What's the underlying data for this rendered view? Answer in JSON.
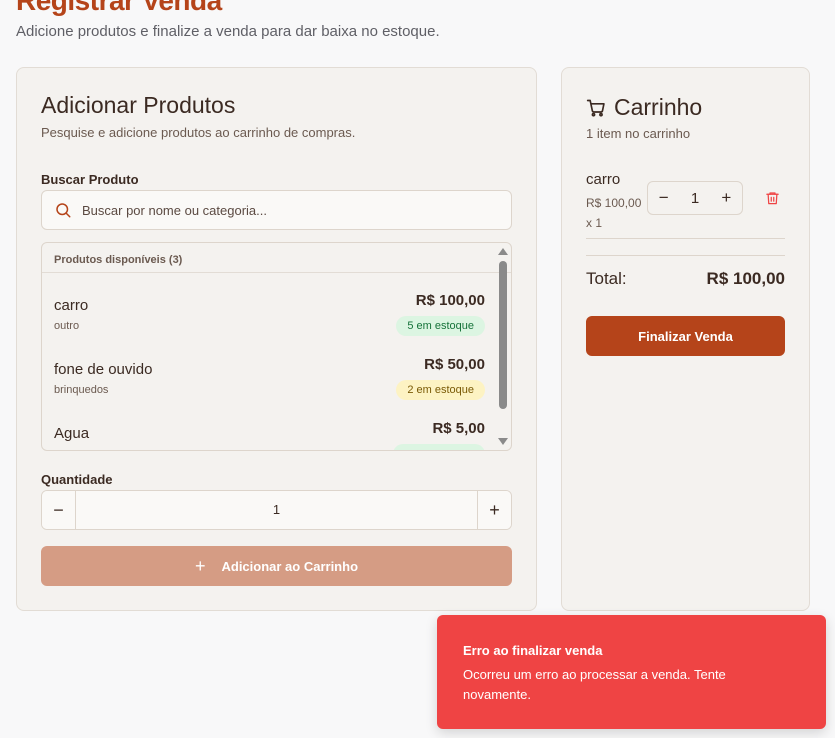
{
  "page": {
    "title": "Registrar Venda",
    "subtitle": "Adicione produtos e finalize a venda para dar baixa no estoque."
  },
  "add_products": {
    "title": "Adicionar Produtos",
    "description": "Pesquise e adicione produtos ao carrinho de compras.",
    "search_label": "Buscar Produto",
    "search_placeholder": "Buscar por nome ou categoria...",
    "search_value": "",
    "list_header": "Produtos disponíveis (3)",
    "products": [
      {
        "name": "carro",
        "category": "outro",
        "price": "R$ 100,00",
        "stock": "5 em estoque",
        "stock_status": "green"
      },
      {
        "name": "fone de ouvido",
        "category": "brinquedos",
        "price": "R$ 50,00",
        "stock": "2 em estoque",
        "stock_status": "yellow"
      },
      {
        "name": "Agua",
        "category": "",
        "price": "R$ 5,00",
        "stock": "",
        "stock_status": "green"
      }
    ],
    "quantity_label": "Quantidade",
    "quantity_value": "1",
    "minus": "−",
    "plus": "+",
    "add_button": "Adicionar ao Carrinho"
  },
  "cart": {
    "title": "Carrinho",
    "count": "1 item no carrinho",
    "items": [
      {
        "name": "carro",
        "price_line": "R$ 100,00 x 1",
        "quantity": "1"
      }
    ],
    "total_label": "Total:",
    "total_value": "R$ 100,00",
    "finalize_button": "Finalizar Venda"
  },
  "toast": {
    "title": "Erro ao finalizar venda",
    "message": "Ocorreu um erro ao processar a venda. Tente novamente."
  },
  "icons": {
    "search": "search-icon",
    "cart": "shopping-cart-icon",
    "trash": "trash-icon",
    "plus": "plus-icon",
    "minus": "minus-icon"
  },
  "colors": {
    "brand": "#b5441a",
    "brand_disabled": "#d59c84",
    "error": "#ef4444",
    "stock_green_bg": "#dcf5e2",
    "stock_yellow_bg": "#fdf3c3"
  }
}
